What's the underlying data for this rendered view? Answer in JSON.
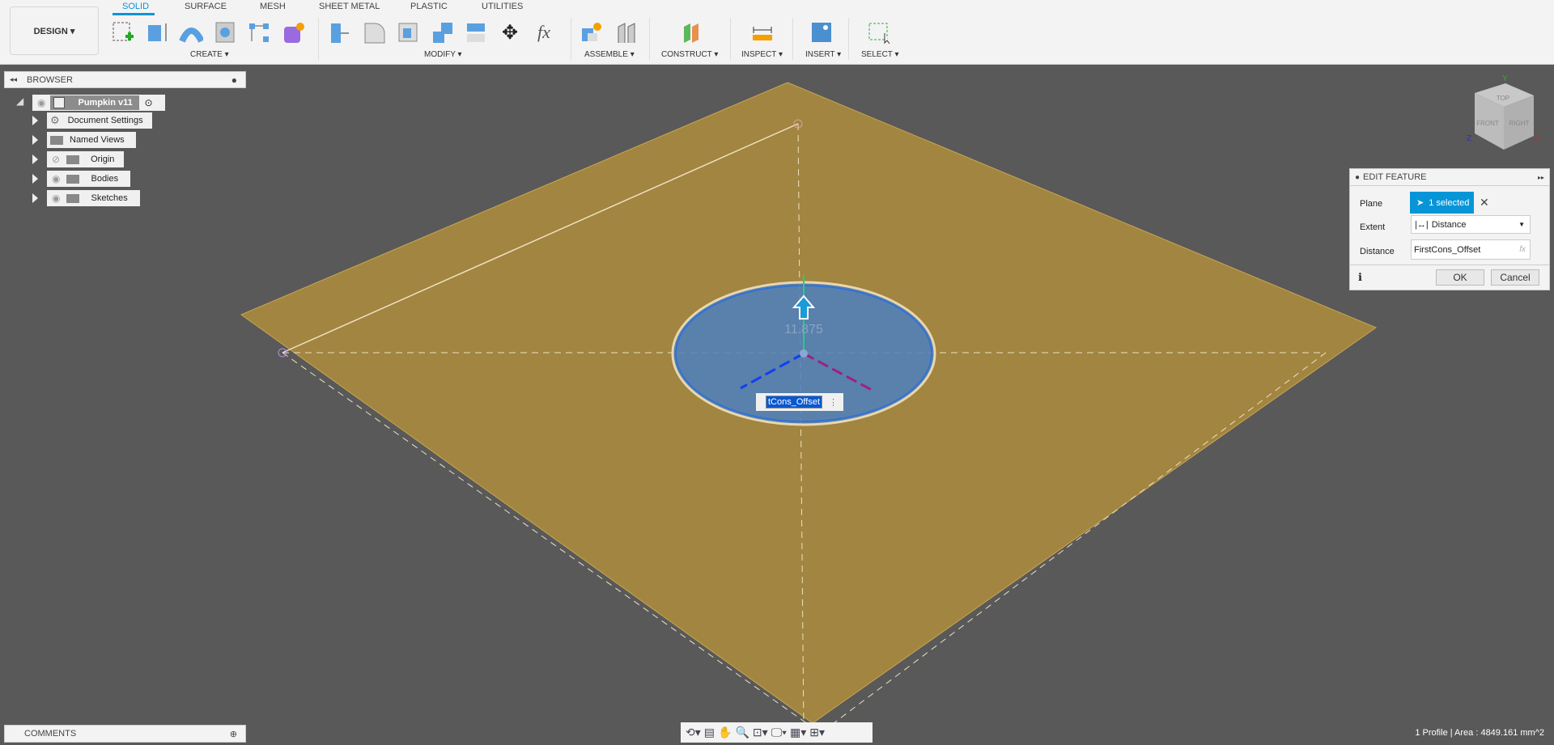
{
  "toolbar": {
    "workspace": "DESIGN ▾",
    "tabs": [
      "SOLID",
      "SURFACE",
      "MESH",
      "SHEET METAL",
      "PLASTIC",
      "UTILITIES"
    ],
    "active_tab": "SOLID",
    "groups": [
      "CREATE ▾",
      "MODIFY ▾",
      "ASSEMBLE ▾",
      "CONSTRUCT ▾",
      "INSPECT ▾",
      "INSERT ▾",
      "SELECT ▾"
    ]
  },
  "browser": {
    "title": "BROWSER",
    "root": "Pumpkin v11",
    "items": [
      "Document Settings",
      "Named Views",
      "Origin",
      "Bodies",
      "Sketches"
    ]
  },
  "viewcube": {
    "faces": [
      "TOP",
      "FRONT",
      "RIGHT"
    ],
    "axes": [
      "Y",
      "Z",
      "X"
    ]
  },
  "edit_feature": {
    "title": "EDIT FEATURE",
    "plane_label": "Plane",
    "plane_value": "1 selected",
    "extent_label": "Extent",
    "extent_value": "Distance",
    "distance_label": "Distance",
    "distance_value": "FirstCons_Offset",
    "fx": "fx",
    "ok": "OK",
    "cancel": "Cancel"
  },
  "canvas": {
    "dimension_ghost": "11.875",
    "input_value": "tCons_Offset"
  },
  "colors": {
    "accent": "#0696d7",
    "plane": "#a88a3d",
    "profile": "#4d7fc0"
  },
  "comments": {
    "label": "COMMENTS"
  },
  "status": "1 Profile | Area : 4849.161 mm^2"
}
